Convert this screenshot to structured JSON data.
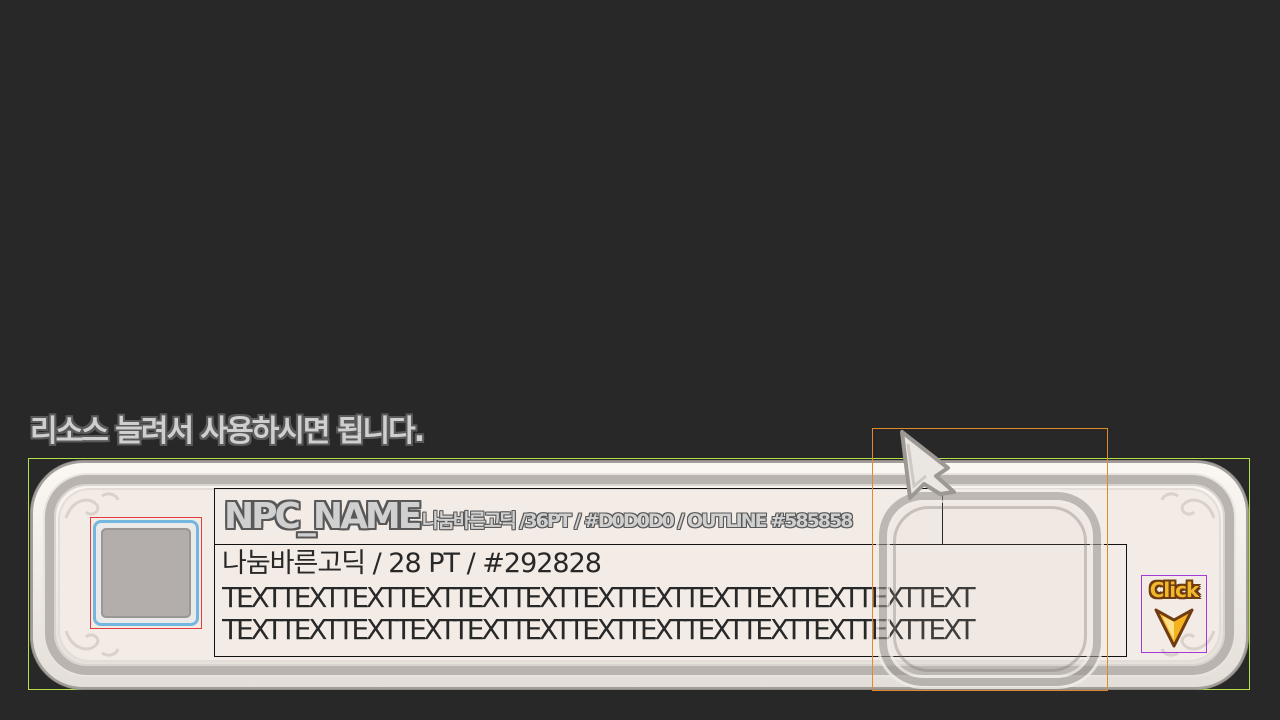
{
  "hint": {
    "text": "리소스 늘려서 사용하시면 됩니다."
  },
  "dialog": {
    "npc_name": "NPC_NAME",
    "name_spec": "나눔바른고딕 /36PT / #D0D0D0 / OUTLINE #585858",
    "body_spec": "나눔바른고딕 / 28 PT / #292828",
    "body_lines": [
      "TEXTTEXTTEXTTEXTTEXTTEXTTEXTTEXTTEXTTEXTTEXTTEXTTEXT",
      "TEXTTEXTTEXTTEXTTEXTTEXTTEXTTEXTTEXTTEXTTEXTTEXTTEXT"
    ],
    "click_button": {
      "label": "Click",
      "icon": "down-arrow-icon"
    },
    "portrait": {
      "icon": "portrait-frame"
    },
    "pointer": {
      "icon": "speech-pointer"
    }
  },
  "colors": {
    "npc_name_fill": "#D0D0D0",
    "npc_name_outline": "#585858",
    "body_text": "#292828",
    "background": "#282828",
    "panel": "#F3EBE5",
    "click_gold": "#F2B82A"
  }
}
